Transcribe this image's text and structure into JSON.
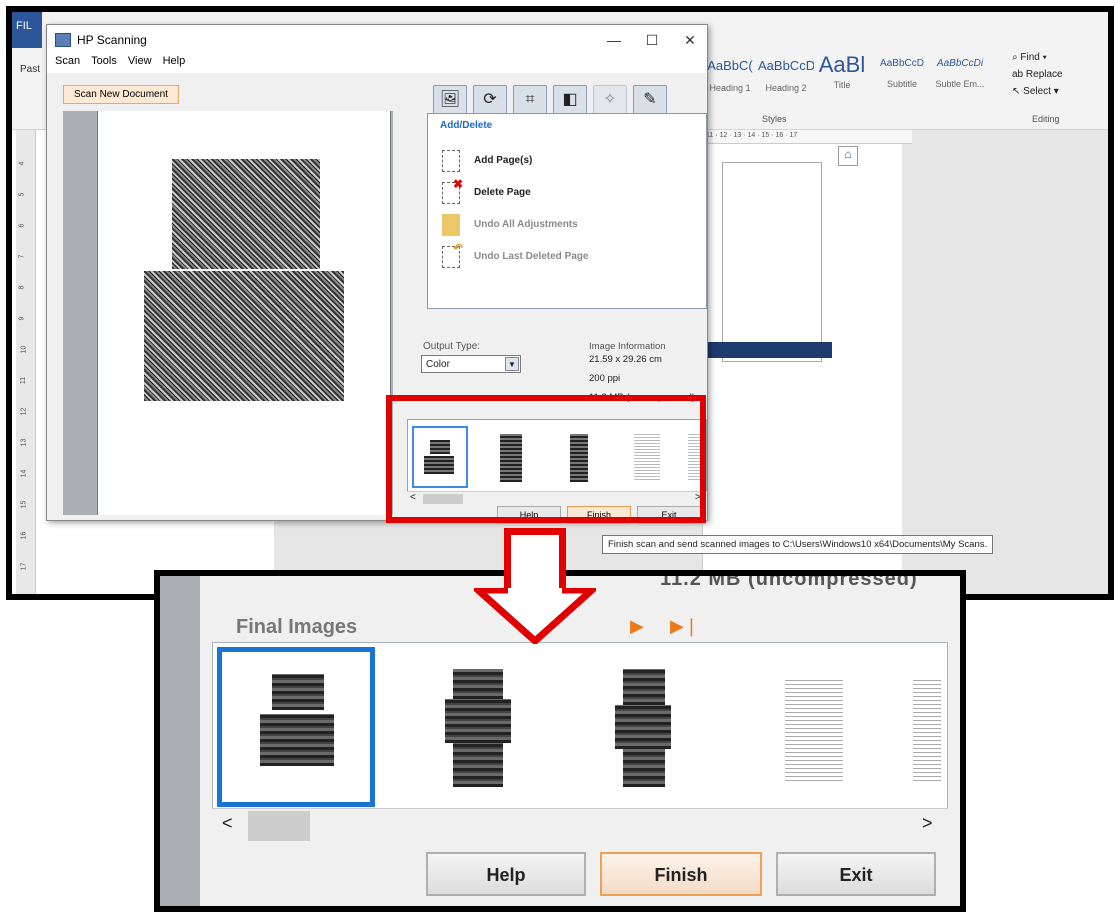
{
  "word": {
    "file_tab": "FIL",
    "paste_label": "Past",
    "styles": [
      {
        "preview": "AaBbC(",
        "name": "Heading 1"
      },
      {
        "preview": "AaBbCcD",
        "name": "Heading 2"
      },
      {
        "preview": "AaBl",
        "name": "Title"
      },
      {
        "preview": "AaBbCcD",
        "name": "Subtitle"
      },
      {
        "preview": "AaBbCcDi",
        "name": "Subtle Em..."
      }
    ],
    "styles_label": "Styles",
    "editing": {
      "find": "Find",
      "replace": "Replace",
      "select": "Select",
      "label": "Editing"
    },
    "ruler_text": "11 · 12 · 13 · 14 · 15 · 16 · 17",
    "vruler": [
      "4",
      "5",
      "6",
      "7",
      "8",
      "9",
      "10",
      "11",
      "12",
      "13",
      "14",
      "15",
      "16",
      "17",
      "18"
    ]
  },
  "hp": {
    "title": "HP Scanning",
    "menu": [
      "Scan",
      "Tools",
      "View",
      "Help"
    ],
    "scan_new": "Scan New Document",
    "panel_title": "Add/Delete",
    "actions": [
      {
        "label": "Add Page(s)",
        "enabled": true
      },
      {
        "label": "Delete Page",
        "enabled": true
      },
      {
        "label": "Undo All Adjustments",
        "enabled": false
      },
      {
        "label": "Undo Last Deleted Page",
        "enabled": false
      }
    ],
    "output_type_label": "Output Type:",
    "output_type_value": "Color",
    "image_info": {
      "title": "Image Information",
      "size": "21.59 x 29.26 cm",
      "dpi": "200 ppi",
      "filesize": "11.2 MB (uncompressed)"
    },
    "buttons": {
      "help": "Help",
      "finish": "Finish",
      "exit": "Exit"
    }
  },
  "tooltip": "Finish scan and send scanned images to C:\\Users\\Windows10 x64\\Documents\\My Scans.",
  "zoom": {
    "cut_text": "11.2 MB (uncompressed)",
    "final_images_label": "Final Images",
    "buttons": {
      "help": "Help",
      "finish": "Finish",
      "exit": "Exit"
    }
  },
  "colors": {
    "highlight": "#e00000",
    "accent_orange": "#ea7b1c",
    "selection_blue": "#1a74d6"
  }
}
